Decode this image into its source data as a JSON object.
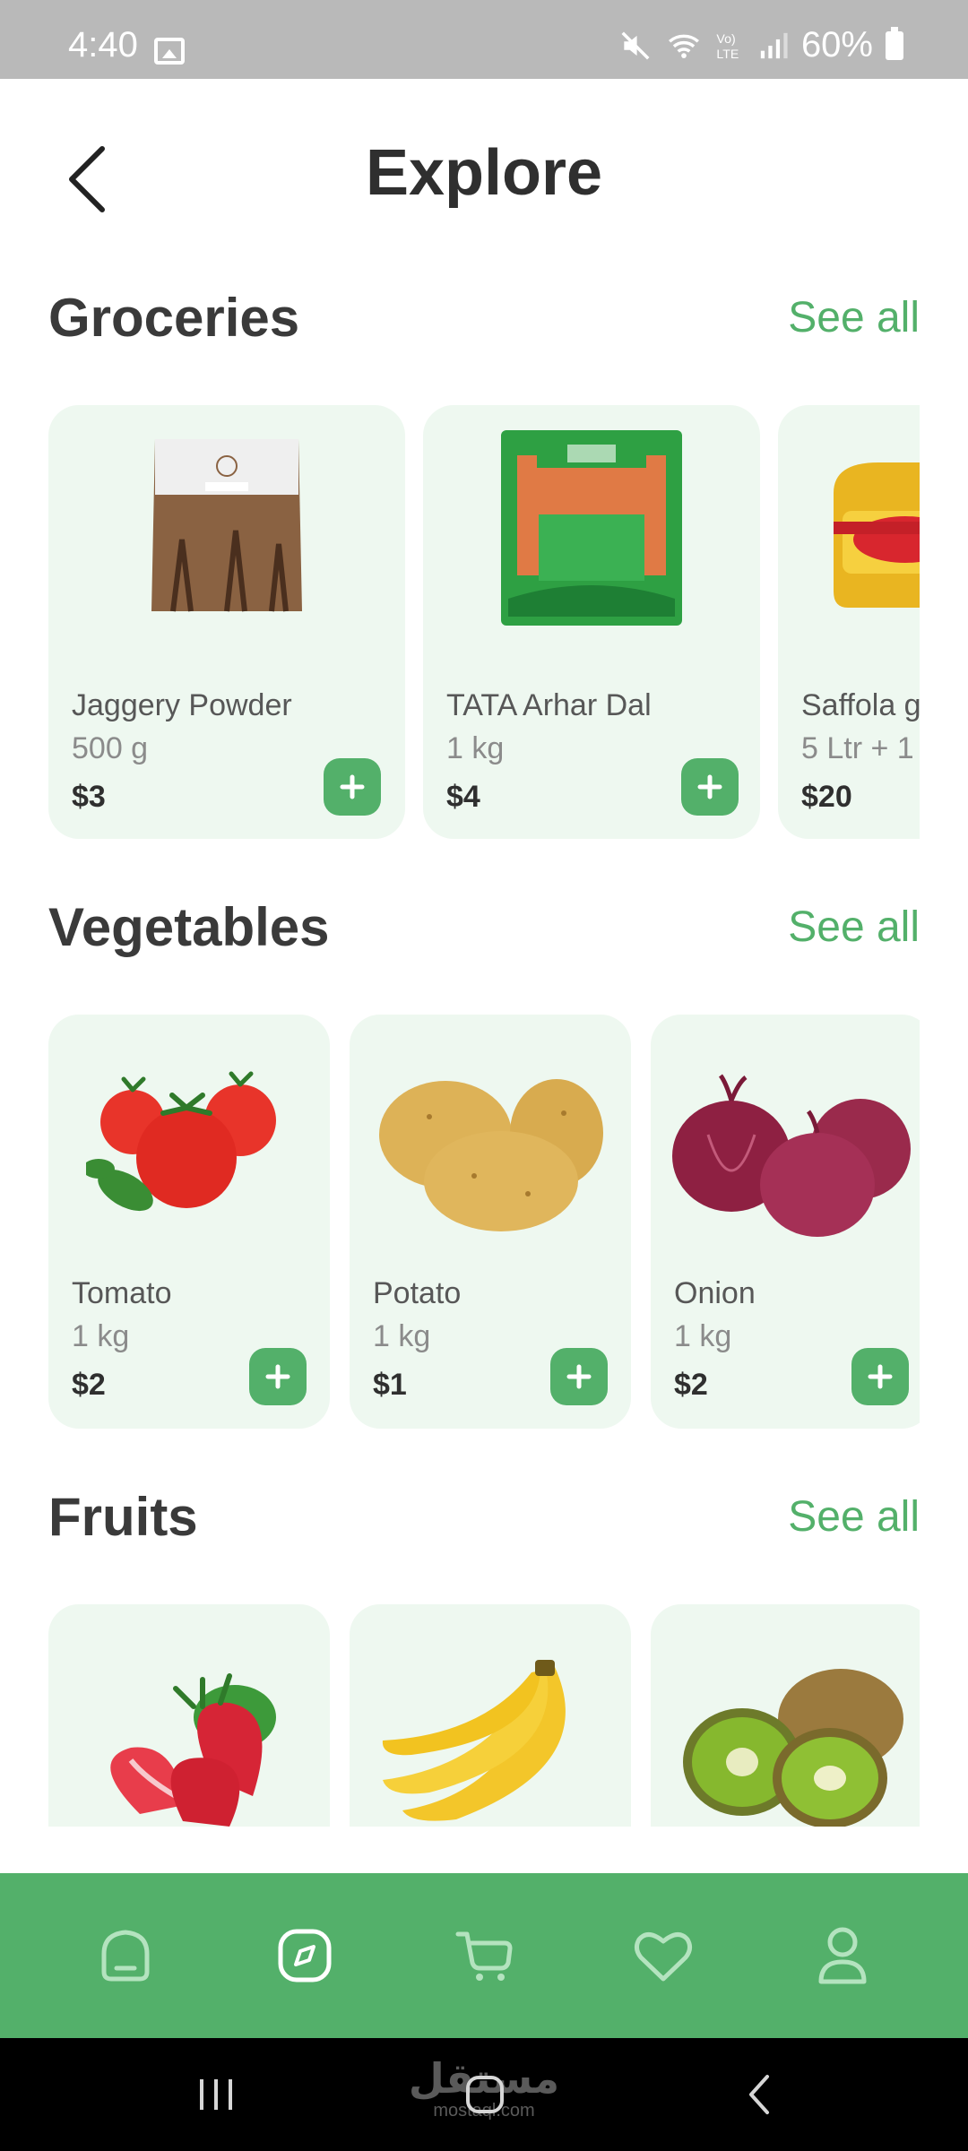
{
  "status_bar": {
    "time": "4:40",
    "battery": "60%"
  },
  "header": {
    "title": "Explore"
  },
  "sections": [
    {
      "title": "Groceries",
      "see_all": "See all",
      "items": [
        {
          "name": "Jaggery Powder",
          "qty": "500 g",
          "price": "$3"
        },
        {
          "name": "TATA Arhar Dal",
          "qty": "1 kg",
          "price": "$4"
        },
        {
          "name": "Saffola gold",
          "qty": "5 Ltr + 1",
          "price": "$20"
        }
      ]
    },
    {
      "title": "Vegetables",
      "see_all": "See all",
      "items": [
        {
          "name": "Tomato",
          "qty": "1 kg",
          "price": "$2"
        },
        {
          "name": "Potato",
          "qty": "1 kg",
          "price": "$1"
        },
        {
          "name": "Onion",
          "qty": "1 kg",
          "price": "$2"
        }
      ]
    },
    {
      "title": "Fruits",
      "see_all": "See all",
      "items": [
        {
          "name": "Strawberry"
        },
        {
          "name": "Banana"
        },
        {
          "name": "Kiwi"
        }
      ]
    }
  ],
  "bottom_nav": [
    "home-icon",
    "explore-icon",
    "cart-icon",
    "favorite-icon",
    "account-icon"
  ],
  "colors": {
    "accent": "#53b06a",
    "card_bg": "#eef8f0",
    "status_bar": "#b9b9b9"
  },
  "watermark": {
    "brand": "مستقل",
    "domain": "mostaql.com"
  }
}
